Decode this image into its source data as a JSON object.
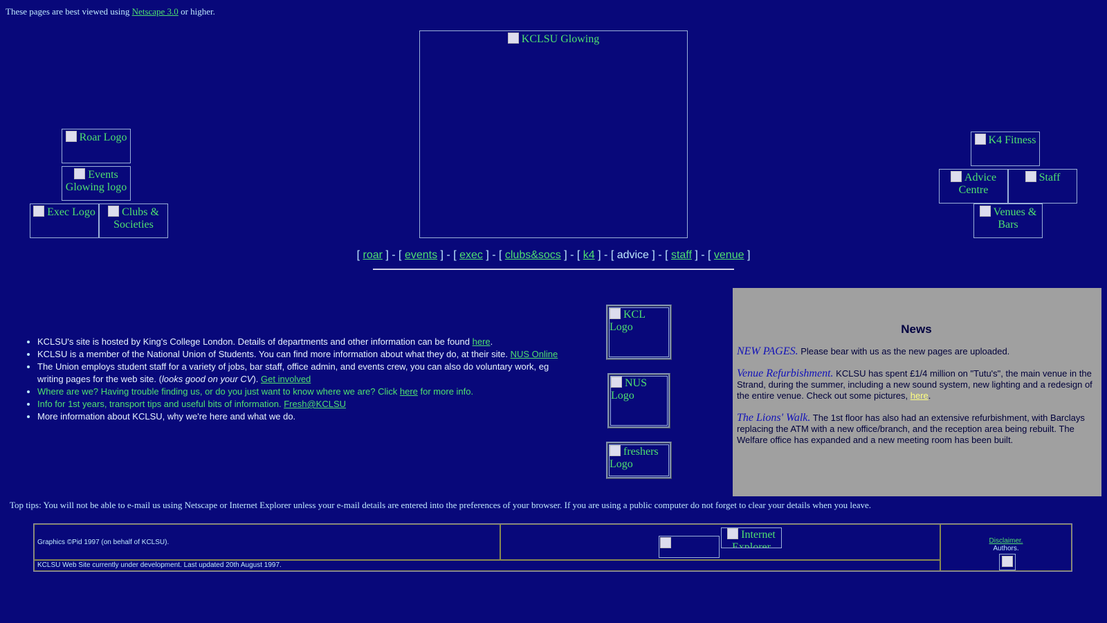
{
  "banner": {
    "prefix": "These pages are best viewed using",
    "link": "Netscape 3.0",
    "suffix": "or higher."
  },
  "images": {
    "main": "KCLSU Glowing",
    "roar": "Roar Logo",
    "events": "Events Glowing logo",
    "exec": "Exec Logo",
    "clubs": "Clubs & Societies",
    "k4": "K4 Fitness",
    "advice": "Advice Centre",
    "staff": "Staff",
    "venues": "Venues & Bars",
    "kcl": "KCL Logo",
    "nus": "NUS Logo",
    "freshers": "freshers Logo",
    "ie": "Internet Explorer"
  },
  "nav": {
    "items": [
      "roar",
      "events",
      "exec",
      "clubs&socs",
      "k4",
      "advice",
      "staff",
      "venue"
    ]
  },
  "bullets": {
    "b1_text": "KCLSU's site is hosted by King's College London. Details of departments and other information can be found ",
    "b1_link": "here",
    "b1_end": ".",
    "b2_text": "KCLSU is a member of the National Union of Students. You can find more information about what they do, at their site. ",
    "b2_link": "NUS Online",
    "b3_text": "The Union employs student staff for a variety of jobs, bar staff, office admin, and events crew, you can also do voluntary work, eg writing pages for the web site. (",
    "b3_em": "looks good on your CV",
    "b3_mid": "). ",
    "b3_link": "Get involved",
    "b4_text": "Where are we? Having trouble finding us, or do you just want to know where we are? Click ",
    "b4_link": "here",
    "b4_end": " for more info.",
    "b5_text": "Info for 1st years, transport tips and useful bits of information. ",
    "b5_link": "Fresh@KCLSU",
    "b6_text": "More information about KCLSU, why we're here and what we do."
  },
  "news": {
    "title": "News",
    "n1_head": "NEW PAGES.",
    "n1_text": " Please bear with us as the new pages are uploaded.",
    "n2_head": "Venue Refurbishment.",
    "n2_text": " KCLSU has spent £1/4 million on \"Tutu's\", the main venue in the Strand, during the summer, including a new sound system, new lighting and a redesign of the entire venue. Check out some pictures, ",
    "n2_link": "here",
    "n2_end": ".",
    "n3_head": "The Lions' Walk.",
    "n3_text": " The 1st floor has also had an extensive refurbishment, with Barclays replacing the ATM with a new office/branch, and the reception area being rebuilt. The Welfare office has expanded and a new meeting room has been built."
  },
  "tips": "Top tips: You will not be able to e-mail us using Netscape or Internet Explorer unless your e-mail details are entered into the preferences of your browser. If you are using a public computer do not forget to clear your details when you leave.",
  "footer": {
    "graphics": "Graphics ©Pid 1997 (on behalf of KCLSU).",
    "status": "KCLSU Web Site currently under development. Last updated 20th August 1997.",
    "disclaimer": "Disclaimer.",
    "authors": "Authors."
  },
  "colors": {
    "background": "#08087a",
    "link": "#4fe070",
    "text": "#bfeaff",
    "news_bg": "#a0a0a0"
  }
}
